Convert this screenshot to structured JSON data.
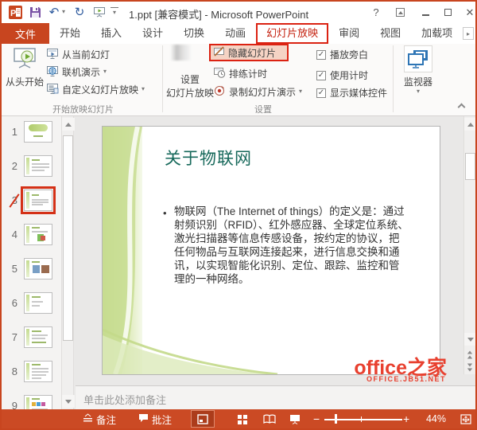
{
  "colors": {
    "accent": "#C8451F",
    "annotation": "#DB2212",
    "slide_title_green": "#17695B",
    "watermark_red": "#E8402F",
    "statusbar": "#CB4A24"
  },
  "glyphs": {
    "caret": "▾",
    "check": "✓",
    "help": "?",
    "close": "✕",
    "overflow": "▸",
    "bullet": "•",
    "zoom_out": "−",
    "zoom_in": "+",
    "undo": "↶",
    "redo": "↻"
  },
  "window": {
    "title": "1.ppt [兼容模式] - Microsoft PowerPoint"
  },
  "tabs": {
    "file": "文件",
    "items": [
      "开始",
      "插入",
      "设计",
      "切换",
      "动画",
      "幻灯片放映",
      "审阅",
      "视图",
      "加载项"
    ],
    "active": "幻灯片放映"
  },
  "ribbon": {
    "start_group": {
      "label": "开始放映幻灯片",
      "from_beginning": "从头开始",
      "from_current": "从当前幻灯",
      "present_online": "联机演示",
      "custom_show": "自定义幻灯片放映"
    },
    "setup_group": {
      "label": "设置",
      "setup_show_line1": "设置",
      "setup_show_line2": "幻灯片放映",
      "hide_slide": "隐藏幻灯片",
      "rehearse_timings": "排练计时",
      "record_show": "录制幻灯片演示",
      "play_narrations": "播放旁白",
      "use_timings": "使用计时",
      "show_media_controls": "显示媒体控件"
    },
    "monitors_group": {
      "button": "监视器"
    }
  },
  "thumbnails": {
    "items": [
      {
        "n": "1"
      },
      {
        "n": "2"
      },
      {
        "n": "3"
      },
      {
        "n": "4"
      },
      {
        "n": "5"
      },
      {
        "n": "6"
      },
      {
        "n": "7"
      },
      {
        "n": "8"
      },
      {
        "n": "9"
      }
    ],
    "selected_slide": "3",
    "hidden_slide": "3"
  },
  "slide": {
    "title": "关于物联网",
    "body_lines": [
      "物联网（The Internet of things）的定义是：通过",
      "射频识别（RFID）、红外感应器、全球定位系统、",
      "激光扫描器等信息传感设备，按约定的协议，把",
      "任何物品与互联网连接起来，进行信息交换和通",
      "讯，以实现智能化识别、定位、跟踪、监控和管",
      "理的一种网络。"
    ]
  },
  "notes": {
    "placeholder": "单击此处添加备注"
  },
  "watermark": {
    "line1": "office之家",
    "line2": "OFFICE.JB51.NET"
  },
  "statusbar": {
    "notes": "备注",
    "comments": "批注",
    "zoom_level": "44%"
  }
}
